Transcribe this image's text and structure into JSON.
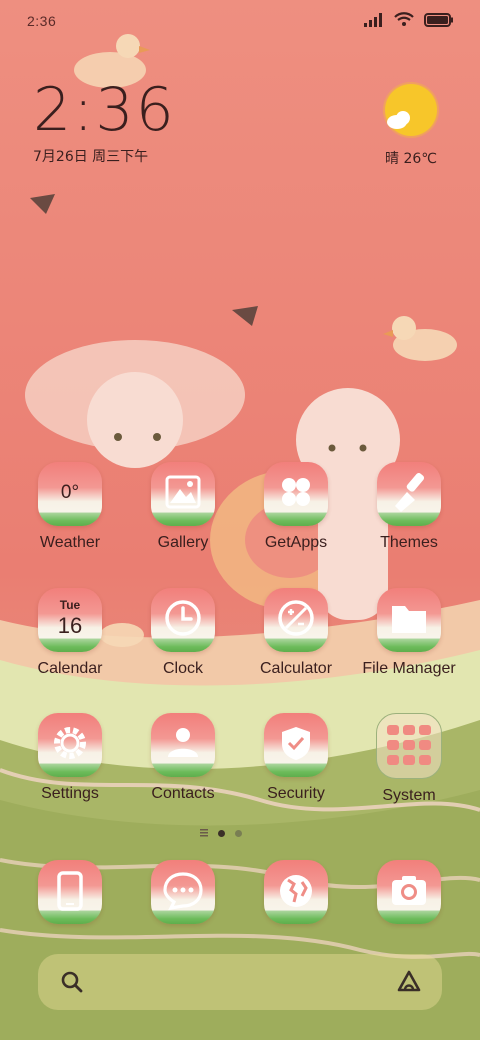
{
  "status_bar": {
    "time": "2:36"
  },
  "clock_widget": {
    "time": "2:36",
    "date": "7月26日 周三下午"
  },
  "weather_widget": {
    "condition_temp": "晴 26℃"
  },
  "apps": {
    "weather": {
      "label": "Weather",
      "temp": "0°"
    },
    "gallery": {
      "label": "Gallery"
    },
    "getapps": {
      "label": "GetApps"
    },
    "themes": {
      "label": "Themes"
    },
    "calendar": {
      "label": "Calendar",
      "day": "Tue",
      "date": "16"
    },
    "clock": {
      "label": "Clock"
    },
    "calculator": {
      "label": "Calculator"
    },
    "file_manager": {
      "label": "File Manager"
    },
    "settings": {
      "label": "Settings"
    },
    "contacts": {
      "label": "Contacts"
    },
    "security": {
      "label": "Security"
    },
    "system": {
      "label": "System"
    }
  },
  "dock": [
    "phone-icon",
    "messaging-icon",
    "browser-icon",
    "camera-icon"
  ],
  "colors": {
    "wallpaper_top": "#ec8d80",
    "rind_green": "#6cbb5a",
    "sun": "#f7c62a"
  }
}
